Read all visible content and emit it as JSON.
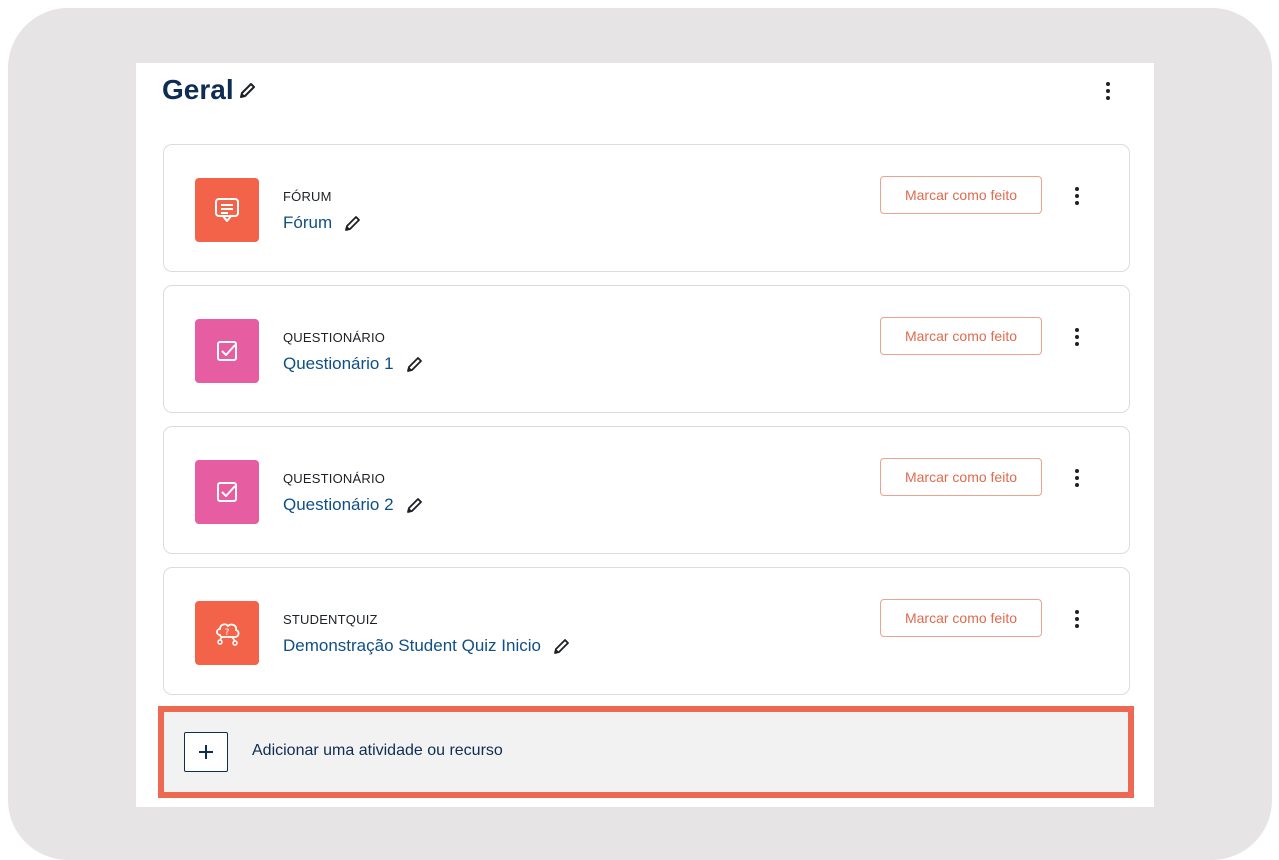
{
  "section": {
    "title": "Geral",
    "menu_icon": "kebab-icon",
    "edit_icon": "pencil-icon"
  },
  "activities": [
    {
      "type": "FÓRUM",
      "name": "Fórum",
      "icon": "forum-icon",
      "icon_color": "#f2634a",
      "button": "Marcar como feito"
    },
    {
      "type": "QUESTIONÁRIO",
      "name": "Questionário 1",
      "icon": "quiz-checkbox-icon",
      "icon_color": "#e65ea1",
      "button": "Marcar como feito"
    },
    {
      "type": "QUESTIONÁRIO",
      "name": "Questionário 2",
      "icon": "quiz-checkbox-icon",
      "icon_color": "#e65ea1",
      "button": "Marcar como feito"
    },
    {
      "type": "STUDENTQUIZ",
      "name": "Demonstração Student Quiz Inicio",
      "icon": "studentquiz-icon",
      "icon_color": "#f2634a",
      "button": "Marcar como feito"
    }
  ],
  "add_activity": {
    "label": "Adicionar uma atividade ou recurso",
    "icon": "plus-icon",
    "highlight_color": "#ec6a52"
  }
}
